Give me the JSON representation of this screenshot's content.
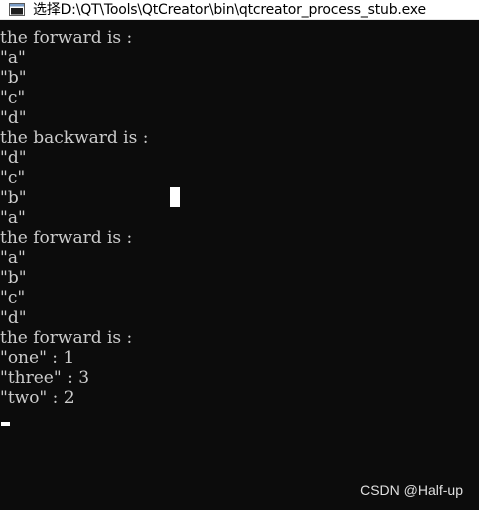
{
  "window": {
    "title": "选择D:\\QT\\Tools\\QtCreator\\bin\\qtcreator_process_stub.exe",
    "icon": "console-window-icon"
  },
  "console": {
    "lines": [
      "the forward is :",
      "\"a\"",
      "\"b\"",
      "\"c\"",
      "\"d\"",
      "the backward is :",
      "\"d\"",
      "\"c\"",
      "\"b\"",
      "\"a\"",
      "the forward is :",
      "\"a\"",
      "\"b\"",
      "\"c\"",
      "\"d\"",
      "the forward is :",
      "\"one\" : 1",
      "\"three\" : 3",
      "\"two\" : 2"
    ]
  },
  "watermark": {
    "text": "CSDN @Half-up"
  },
  "colors": {
    "console_background": "#0c0c0c",
    "console_text": "#cccccc",
    "titlebar_background": "#ffffff"
  }
}
